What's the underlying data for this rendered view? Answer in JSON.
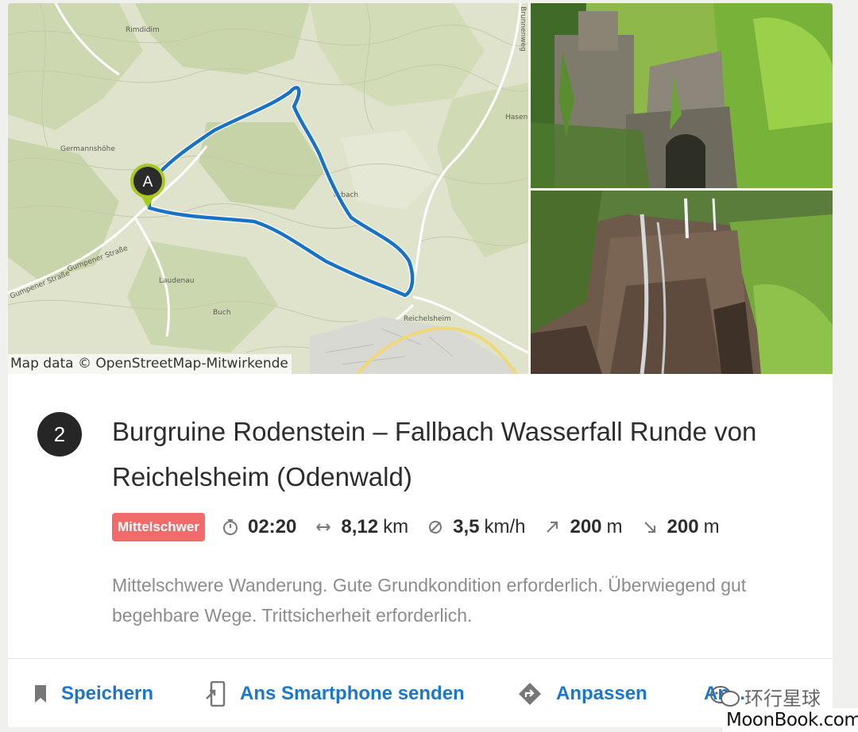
{
  "map": {
    "attribution": "Map data © OpenStreetMap-Mitwirkende",
    "marker_label": "A",
    "places": {
      "rimdidim": "Rimdidim",
      "germannshohe": "Germannshöhe",
      "laudenau": "Laudenau",
      "buch": "Buch",
      "reichelsheim": "Reichelsheim",
      "gumpener_strasse_1": "Gumpener Straße",
      "gumpener_strasse_2": "Gumpener Straße",
      "brunnenweg": "Brunnenweg",
      "hasenb": "Hasenb",
      "erbach": "erbach"
    },
    "route_color": "#1a72c4"
  },
  "route": {
    "number": "2",
    "title": "Burgruine Rodenstein – Fallbach Wasserfall Runde von Reichelsheim (Odenwald)",
    "difficulty": "Mittelschwer",
    "difficulty_color": "#f26b6b",
    "duration": "02:20",
    "distance_value": "8,12",
    "distance_unit": "km",
    "speed_value": "3,5",
    "speed_unit": "km/h",
    "ascent_value": "200",
    "ascent_unit": "m",
    "descent_value": "200",
    "descent_unit": "m",
    "description": "Mittelschwere Wanderung. Gute Grundkondition erforderlich. Überwiegend gut begehbare Wege. Trittsicherheit erforderlich."
  },
  "actions": {
    "save": "Speichern",
    "send": "Ans Smartphone senden",
    "adjust": "Anpassen",
    "more": "An..."
  },
  "watermark": {
    "text": "环行星球",
    "site": "MoonBook.com"
  },
  "icons": {
    "stopwatch": "stopwatch-icon",
    "distance": "horizontal-arrows-icon",
    "speed": "average-speed-icon",
    "ascent": "arrow-up-right-icon",
    "descent": "arrow-down-right-icon",
    "bookmark": "bookmark-icon",
    "send": "send-to-phone-icon",
    "adjust": "directions-diamond-icon"
  },
  "colors": {
    "accent": "#1b77ce",
    "badge": "#262626"
  }
}
